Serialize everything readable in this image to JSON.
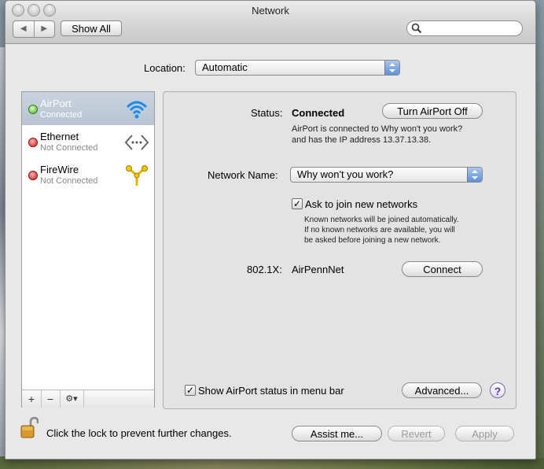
{
  "window": {
    "title": "Network"
  },
  "toolbar": {
    "show_all": "Show All",
    "back_icon": "back-arrow-icon",
    "forward_icon": "forward-arrow-icon",
    "search_icon": "search-icon"
  },
  "location": {
    "label": "Location:",
    "value": "Automatic"
  },
  "services": [
    {
      "name": "AirPort",
      "status": "Connected",
      "status_color": "#4caf28",
      "icon": "wifi-icon",
      "selected": true
    },
    {
      "name": "Ethernet",
      "status": "Not Connected",
      "status_color": "#d21a1a",
      "icon": "ethernet-icon",
      "selected": false
    },
    {
      "name": "FireWire",
      "status": "Not Connected",
      "status_color": "#d21a1a",
      "icon": "firewire-icon",
      "selected": false
    }
  ],
  "sidebar_tools": {
    "add": "+",
    "remove": "−",
    "gear": "⚙▾"
  },
  "detail": {
    "status_label": "Status:",
    "status_value": "Connected",
    "turn_off_button": "Turn AirPort Off",
    "status_desc_1": "AirPort is connected to Why won't you work?",
    "status_desc_2": "and has the IP address 13.37.13.38.",
    "network_name_label": "Network Name:",
    "network_name_value": "Why won't you work?",
    "ask_join_label": "Ask to join new networks",
    "ask_join_checked": true,
    "ask_desc_1": "Known networks will be joined automatically.",
    "ask_desc_2": "If no known networks are available, you will",
    "ask_desc_3": "be asked before joining a new network.",
    "dot1x_label": "802.1X:",
    "dot1x_value": "AirPennNet",
    "connect_button": "Connect",
    "show_status_label": "Show AirPort status in menu bar",
    "show_status_checked": true,
    "advanced_button": "Advanced...",
    "help": "?"
  },
  "footer": {
    "lock_text": "Click the lock to prevent further changes.",
    "assist_button": "Assist me...",
    "revert_button": "Revert",
    "apply_button": "Apply"
  }
}
